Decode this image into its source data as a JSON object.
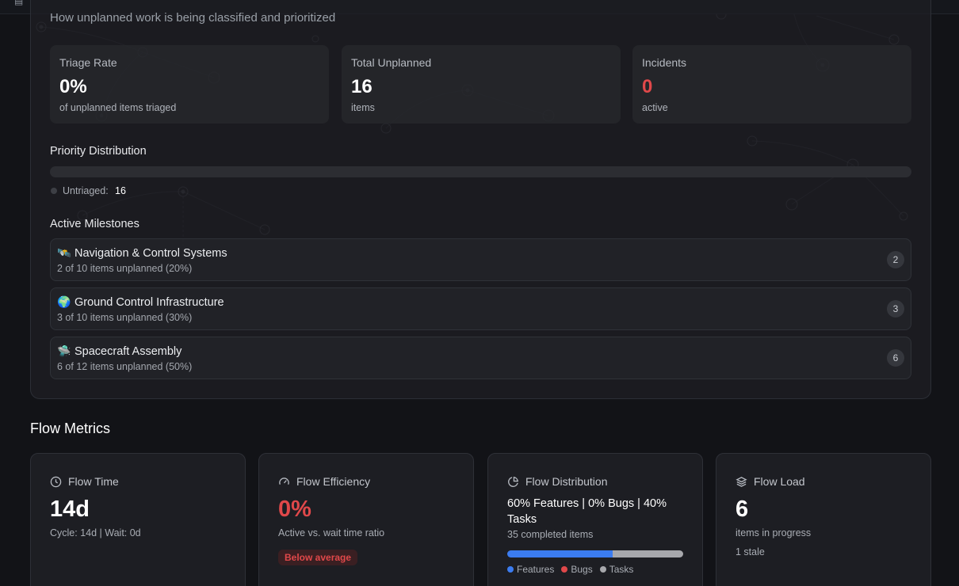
{
  "triage": {
    "subtitle": "How unplanned work is being classified and prioritized",
    "stats": [
      {
        "label": "Triage Rate",
        "value": "0%",
        "sub": "of unplanned items triaged"
      },
      {
        "label": "Total Unplanned",
        "value": "16",
        "sub": "items"
      },
      {
        "label": "Incidents",
        "value": "0",
        "sub": "active"
      }
    ],
    "priority": {
      "title": "Priority Distribution",
      "legend_label": "Untriaged:",
      "legend_value": "16"
    },
    "milestones_title": "Active Milestones",
    "milestones": [
      {
        "emoji": "🛰️",
        "title": "Navigation & Control Systems",
        "sub": "2 of 10 items unplanned (20%)",
        "count": "2"
      },
      {
        "emoji": "🌍",
        "title": "Ground Control Infrastructure",
        "sub": "3 of 10 items unplanned (30%)",
        "count": "3"
      },
      {
        "emoji": "🛸",
        "title": "Spacecraft Assembly",
        "sub": "6 of 12 items unplanned (50%)",
        "count": "6"
      }
    ]
  },
  "flow": {
    "title": "Flow Metrics",
    "time": {
      "label": "Flow Time",
      "value": "14d",
      "sub": "Cycle: 14d | Wait: 0d"
    },
    "efficiency": {
      "label": "Flow Efficiency",
      "value": "0%",
      "sub": "Active vs. wait time ratio",
      "badge": "Below average"
    },
    "distribution": {
      "label": "Flow Distribution",
      "summary": "60% Features | 0% Bugs | 40% Tasks",
      "sub": "35 completed items",
      "segments": [
        {
          "name": "Features",
          "percent": 60,
          "color": "#3b7cf0"
        },
        {
          "name": "Bugs",
          "percent": 0,
          "color": "#e0484a"
        },
        {
          "name": "Tasks",
          "percent": 40,
          "color": "#a7a8ac"
        }
      ]
    },
    "load": {
      "label": "Flow Load",
      "value": "6",
      "sub": "items in progress",
      "sub2": "1 stale"
    }
  }
}
